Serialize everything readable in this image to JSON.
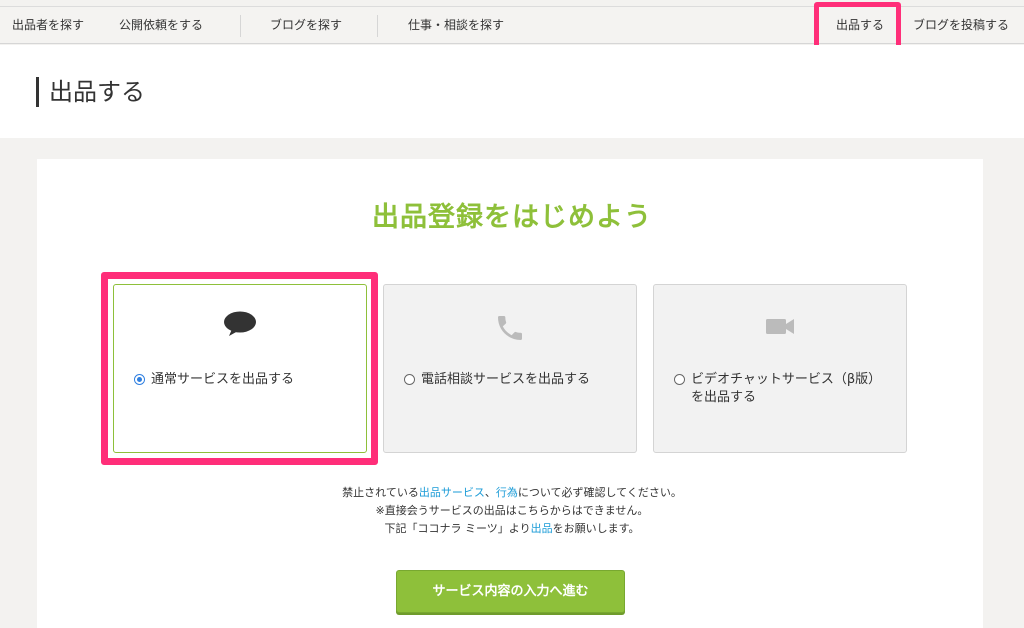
{
  "nav": {
    "find_sellers": "出品者を探す",
    "post_request": "公開依頼をする",
    "find_blogs": "ブログを探す",
    "find_jobs": "仕事・相談を探す",
    "sell": "出品する",
    "post_blog": "ブログを投稿する"
  },
  "page": {
    "title": "出品する"
  },
  "main": {
    "heading": "出品登録をはじめよう",
    "options": [
      {
        "label": "通常サービスを出品する",
        "icon": "speech-bubble-icon",
        "selected": true
      },
      {
        "label": "電話相談サービスを出品する",
        "icon": "phone-icon",
        "selected": false
      },
      {
        "label_line1": "ビデオチャットサービス（β版）",
        "label_line2": "を出品する",
        "icon": "video-camera-icon",
        "selected": false
      }
    ],
    "notice": {
      "pre": "禁止されている",
      "link1": "出品サービス",
      "sep": "、",
      "link2": "行為",
      "post": "について必ず確認してください。",
      "warn1": "※直接会うサービスの出品はこちらからはできません。",
      "warn2_pre": "下記「ココナラ ミーツ」より",
      "warn2_link": "出品",
      "warn2_post": "をお願いします。"
    },
    "cta": "サービス内容の入力へ進む"
  },
  "colors": {
    "accent": "#8ec03a",
    "link": "#1a9bd7",
    "warning": "#e7312b",
    "highlight": "#ff2e79"
  }
}
